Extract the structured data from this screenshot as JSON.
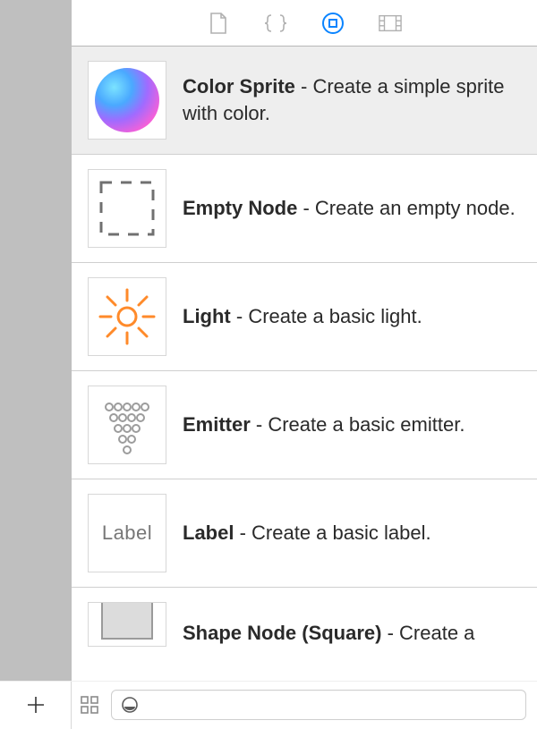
{
  "toolbar": {
    "active_index": 2
  },
  "items": [
    {
      "title": "Color Sprite",
      "desc": " - Create a simple sprite with color."
    },
    {
      "title": "Empty Node",
      "desc": " - Create an empty node."
    },
    {
      "title": "Light",
      "desc": " - Create a basic light."
    },
    {
      "title": "Emitter",
      "desc": " - Create a basic emitter."
    },
    {
      "title": "Label",
      "desc": " - Create a basic label."
    },
    {
      "title": "Shape Node (Square)",
      "desc": " - Create a"
    }
  ],
  "label_thumb_text": "Label",
  "selected_index": 0
}
